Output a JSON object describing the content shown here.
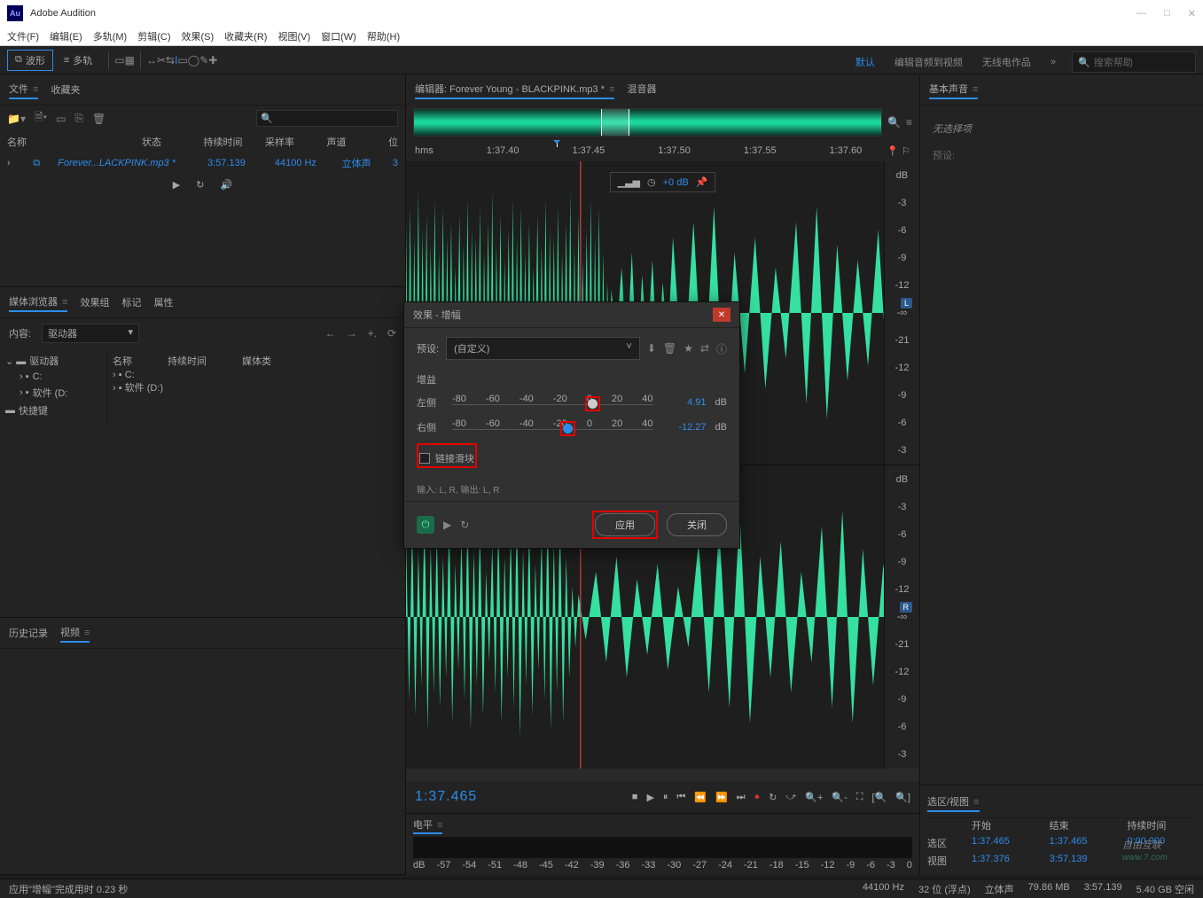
{
  "app": {
    "title": "Adobe Audition",
    "logo": "Au"
  },
  "menu": [
    "文件(F)",
    "编辑(E)",
    "多轨(M)",
    "剪辑(C)",
    "效果(S)",
    "收藏夹(R)",
    "视图(V)",
    "窗口(W)",
    "帮助(H)"
  ],
  "toolbar": {
    "waveform": "波形",
    "multitrack": "多轨"
  },
  "workspace": {
    "default": "默认",
    "editAudio": "编辑音频到视频",
    "radio": "无线电作品",
    "searchPH": "搜索帮助"
  },
  "filesPanel": {
    "tab1": "文件",
    "tab2": "收藏夹",
    "cols": {
      "name": "名称",
      "status": "状态",
      "duration": "持续时间",
      "sr": "采样率",
      "ch": "声道",
      "bit": "位"
    }
  },
  "file": {
    "name": "Forever...LACKPINK.mp3 *",
    "dur": "3:57.139",
    "sr": "44100 Hz",
    "ch": "立体声",
    "bit": "3"
  },
  "mediaPanel": {
    "t1": "媒体浏览器",
    "t2": "效果组",
    "t3": "标记",
    "t4": "属性",
    "contentLbl": "内容:",
    "driver": "驱动器",
    "nameCol": "名称",
    "durCol": "持续时间",
    "typeCol": "媒体类",
    "tree": {
      "root": "驱动器",
      "c": "C:",
      "soft": "软件 (D:",
      "sc": "快捷键",
      "c2": "C:",
      "soft2": "软件 (D:)"
    }
  },
  "historyPanel": {
    "t1": "历史记录",
    "t2": "视频"
  },
  "editor": {
    "tab": "编辑器: Forever Young - BLACKPINK.mp3 *",
    "mixer": "混音器",
    "ruler": [
      "hms",
      "1:37.40",
      "1:37.45",
      "1:37.50",
      "1:37.55",
      "1:37.60"
    ],
    "dbLabel": "dB",
    "dbTicks": [
      "-3",
      "-6",
      "-9",
      "-12",
      "-∞",
      "-21",
      "-12",
      "-9",
      "-6",
      "-3"
    ],
    "L": "L",
    "R": "R",
    "hud": "+0 dB"
  },
  "transport": {
    "tc": "1:37.465"
  },
  "level": {
    "tab": "电平",
    "ticks": [
      "dB",
      "-57",
      "-54",
      "-51",
      "-48",
      "-45",
      "-42",
      "-39",
      "-36",
      "-33",
      "-30",
      "-27",
      "-24",
      "-21",
      "-18",
      "-15",
      "-12",
      "-9",
      "-6",
      "-3",
      "0"
    ]
  },
  "rightPanel": {
    "title": "基本声音",
    "noSel": "无选择项",
    "preset": "预设:"
  },
  "selView": {
    "title": "选区/视图",
    "cols": [
      "开始",
      "结束",
      "持续时间"
    ],
    "selLbl": "选区",
    "viewLbl": "视图",
    "selStart": "1:37.465",
    "selEnd": "1:37.465",
    "selDur": "0:00.000",
    "vStart": "1:37.376",
    "vEnd": "3:57.139",
    "vDur": ""
  },
  "status": {
    "left": "应用\"增幅\"完成用时 0.23 秒",
    "r1": "44100 Hz",
    "r2": "32 位 (浮点)",
    "r3": "立体声",
    "r4": "79.86 MB",
    "r5": "3:57.139",
    "r6": "5.40 GB 空闲"
  },
  "dialog": {
    "title": "效果 - 增幅",
    "presetLbl": "预设:",
    "presetVal": "(自定义)",
    "gain": "增益",
    "left": "左侧",
    "right": "右侧",
    "ticks": [
      "-80",
      "-60",
      "-40",
      "-20",
      "0",
      "20",
      "40"
    ],
    "leftVal": "4.91",
    "rightVal": "-12.27",
    "unit": "dB",
    "link": "链接滑块",
    "io": "输入: L, R,  输出: L, R",
    "apply": "应用",
    "close": "关闭"
  },
  "watermark": {
    "t1": "自由互联",
    "t2": "www.?.com"
  }
}
